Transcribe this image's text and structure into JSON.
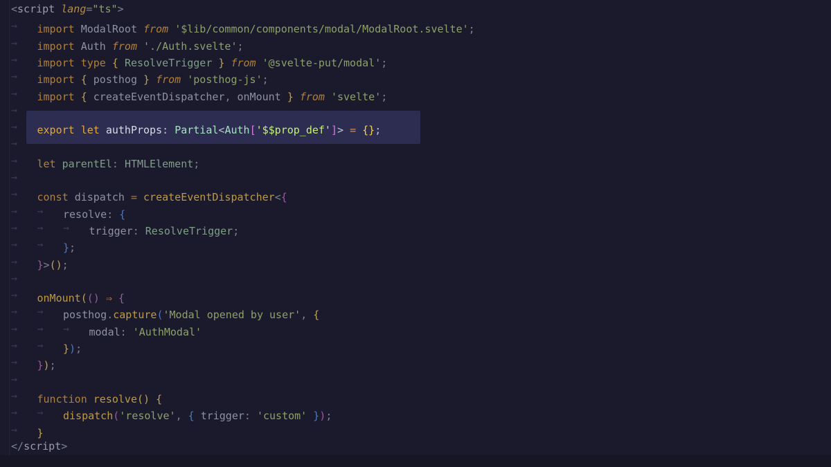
{
  "app": {
    "theme": {
      "background": "#1a1a2c",
      "current_line": "#2d2d52",
      "keyword": "#b0803a",
      "string": "#8ea06a",
      "type": "#7f9f86",
      "function": "#c09a3f"
    }
  },
  "editor": {
    "highlighted_line": 8,
    "lines": [
      {
        "tokens": [
          {
            "t": "<",
            "c": "t-p"
          },
          {
            "t": "script",
            "c": "t-tg"
          },
          {
            "t": " ",
            "c": ""
          },
          {
            "t": "lang",
            "c": "t-at"
          },
          {
            "t": "=",
            "c": "t-p"
          },
          {
            "t": "\"ts\"",
            "c": "t-st"
          },
          {
            "t": ">",
            "c": "t-p"
          }
        ]
      },
      {
        "indent": 1,
        "tokens": [
          {
            "t": "import",
            "c": "t-kw"
          },
          {
            "t": " ",
            "c": ""
          },
          {
            "t": "ModalRoot",
            "c": "t-id"
          },
          {
            "t": " ",
            "c": ""
          },
          {
            "t": "from",
            "c": "t-fr"
          },
          {
            "t": " ",
            "c": ""
          },
          {
            "t": "'$lib/common/components/modal/ModalRoot.svelte'",
            "c": "t-st"
          },
          {
            "t": ";",
            "c": "t-p"
          }
        ]
      },
      {
        "indent": 1,
        "tokens": [
          {
            "t": "import",
            "c": "t-kw"
          },
          {
            "t": " ",
            "c": ""
          },
          {
            "t": "Auth",
            "c": "t-id"
          },
          {
            "t": " ",
            "c": ""
          },
          {
            "t": "from",
            "c": "t-fr"
          },
          {
            "t": " ",
            "c": ""
          },
          {
            "t": "'./Auth.svelte'",
            "c": "t-st"
          },
          {
            "t": ";",
            "c": "t-p"
          }
        ]
      },
      {
        "indent": 1,
        "tokens": [
          {
            "t": "import",
            "c": "t-kw"
          },
          {
            "t": " ",
            "c": ""
          },
          {
            "t": "type",
            "c": "t-kw"
          },
          {
            "t": " ",
            "c": ""
          },
          {
            "t": "{",
            "c": "t-b1"
          },
          {
            "t": " ",
            "c": ""
          },
          {
            "t": "ResolveTrigger",
            "c": "t-ty"
          },
          {
            "t": " ",
            "c": ""
          },
          {
            "t": "}",
            "c": "t-b1"
          },
          {
            "t": " ",
            "c": ""
          },
          {
            "t": "from",
            "c": "t-fr"
          },
          {
            "t": " ",
            "c": ""
          },
          {
            "t": "'@svelte-put/modal'",
            "c": "t-st"
          },
          {
            "t": ";",
            "c": "t-p"
          }
        ]
      },
      {
        "indent": 1,
        "tokens": [
          {
            "t": "import",
            "c": "t-kw"
          },
          {
            "t": " ",
            "c": ""
          },
          {
            "t": "{",
            "c": "t-b1"
          },
          {
            "t": " ",
            "c": ""
          },
          {
            "t": "posthog",
            "c": "t-id"
          },
          {
            "t": " ",
            "c": ""
          },
          {
            "t": "}",
            "c": "t-b1"
          },
          {
            "t": " ",
            "c": ""
          },
          {
            "t": "from",
            "c": "t-fr"
          },
          {
            "t": " ",
            "c": ""
          },
          {
            "t": "'posthog-js'",
            "c": "t-st"
          },
          {
            "t": ";",
            "c": "t-p"
          }
        ]
      },
      {
        "indent": 1,
        "tokens": [
          {
            "t": "import",
            "c": "t-kw"
          },
          {
            "t": " ",
            "c": ""
          },
          {
            "t": "{",
            "c": "t-b1"
          },
          {
            "t": " ",
            "c": ""
          },
          {
            "t": "createEventDispatcher",
            "c": "t-id"
          },
          {
            "t": ",",
            "c": "t-p"
          },
          {
            "t": " ",
            "c": ""
          },
          {
            "t": "onMount",
            "c": "t-id"
          },
          {
            "t": " ",
            "c": ""
          },
          {
            "t": "}",
            "c": "t-b1"
          },
          {
            "t": " ",
            "c": ""
          },
          {
            "t": "from",
            "c": "t-fr"
          },
          {
            "t": " ",
            "c": ""
          },
          {
            "t": "'svelte'",
            "c": "t-st"
          },
          {
            "t": ";",
            "c": "t-p"
          }
        ]
      },
      {
        "indent": 1,
        "tokens": []
      },
      {
        "indent": 1,
        "tokens": [
          {
            "t": "export",
            "c": "t-kw"
          },
          {
            "t": " ",
            "c": ""
          },
          {
            "t": "let",
            "c": "t-kw"
          },
          {
            "t": " ",
            "c": ""
          },
          {
            "t": "authProps",
            "c": "t-id"
          },
          {
            "t": ":",
            "c": "t-p"
          },
          {
            "t": " ",
            "c": ""
          },
          {
            "t": "Partial",
            "c": "t-ty"
          },
          {
            "t": "<",
            "c": "t-p"
          },
          {
            "t": "Auth",
            "c": "t-ty"
          },
          {
            "t": "[",
            "c": "t-b2"
          },
          {
            "t": "'$$prop_def'",
            "c": "t-st"
          },
          {
            "t": "]",
            "c": "t-b2"
          },
          {
            "t": ">",
            "c": "t-p"
          },
          {
            "t": " ",
            "c": ""
          },
          {
            "t": "=",
            "c": "t-op"
          },
          {
            "t": " ",
            "c": ""
          },
          {
            "t": "{}",
            "c": "t-b1"
          },
          {
            "t": ";",
            "c": "t-p"
          }
        ]
      },
      {
        "indent": 1,
        "tokens": []
      },
      {
        "indent": 1,
        "tokens": [
          {
            "t": "let",
            "c": "t-kw"
          },
          {
            "t": " ",
            "c": ""
          },
          {
            "t": "parentEl",
            "c": "t-ty"
          },
          {
            "t": ":",
            "c": "t-p"
          },
          {
            "t": " ",
            "c": ""
          },
          {
            "t": "HTMLElement",
            "c": "t-ty"
          },
          {
            "t": ";",
            "c": "t-p"
          }
        ]
      },
      {
        "indent": 1,
        "tokens": []
      },
      {
        "indent": 1,
        "tokens": [
          {
            "t": "const",
            "c": "t-kw"
          },
          {
            "t": " ",
            "c": ""
          },
          {
            "t": "dispatch",
            "c": "t-id"
          },
          {
            "t": " ",
            "c": ""
          },
          {
            "t": "=",
            "c": "t-op"
          },
          {
            "t": " ",
            "c": ""
          },
          {
            "t": "createEventDispatcher",
            "c": "t-fn"
          },
          {
            "t": "<",
            "c": "t-p"
          },
          {
            "t": "{",
            "c": "t-b2"
          }
        ]
      },
      {
        "indent": 2,
        "tokens": [
          {
            "t": "resolve",
            "c": "t-pr"
          },
          {
            "t": ":",
            "c": "t-p"
          },
          {
            "t": " ",
            "c": ""
          },
          {
            "t": "{",
            "c": "t-b3"
          }
        ]
      },
      {
        "indent": 3,
        "tokens": [
          {
            "t": "trigger",
            "c": "t-pr"
          },
          {
            "t": ":",
            "c": "t-p"
          },
          {
            "t": " ",
            "c": ""
          },
          {
            "t": "ResolveTrigger",
            "c": "t-ty"
          },
          {
            "t": ";",
            "c": "t-p"
          }
        ]
      },
      {
        "indent": 2,
        "tokens": [
          {
            "t": "}",
            "c": "t-b3"
          },
          {
            "t": ";",
            "c": "t-p"
          }
        ]
      },
      {
        "indent": 1,
        "tokens": [
          {
            "t": "}",
            "c": "t-b2"
          },
          {
            "t": ">",
            "c": "t-p"
          },
          {
            "t": "()",
            "c": "t-b1"
          },
          {
            "t": ";",
            "c": "t-p"
          }
        ]
      },
      {
        "indent": 1,
        "tokens": []
      },
      {
        "indent": 1,
        "tokens": [
          {
            "t": "onMount",
            "c": "t-fn"
          },
          {
            "t": "(",
            "c": "t-b1"
          },
          {
            "t": "()",
            "c": "t-b2"
          },
          {
            "t": " ",
            "c": ""
          },
          {
            "t": "⇒",
            "c": "t-op"
          },
          {
            "t": " ",
            "c": ""
          },
          {
            "t": "{",
            "c": "t-b2"
          }
        ]
      },
      {
        "indent": 2,
        "tokens": [
          {
            "t": "posthog",
            "c": "t-id"
          },
          {
            "t": ".",
            "c": "t-p"
          },
          {
            "t": "capture",
            "c": "t-fn"
          },
          {
            "t": "(",
            "c": "t-b3"
          },
          {
            "t": "'Modal opened by user'",
            "c": "t-st"
          },
          {
            "t": ",",
            "c": "t-p"
          },
          {
            "t": " ",
            "c": ""
          },
          {
            "t": "{",
            "c": "t-b1"
          }
        ]
      },
      {
        "indent": 3,
        "tokens": [
          {
            "t": "modal",
            "c": "t-pr"
          },
          {
            "t": ":",
            "c": "t-p"
          },
          {
            "t": " ",
            "c": ""
          },
          {
            "t": "'AuthModal'",
            "c": "t-st"
          }
        ]
      },
      {
        "indent": 2,
        "tokens": [
          {
            "t": "}",
            "c": "t-b1"
          },
          {
            "t": ")",
            "c": "t-b3"
          },
          {
            "t": ";",
            "c": "t-p"
          }
        ]
      },
      {
        "indent": 1,
        "tokens": [
          {
            "t": "}",
            "c": "t-b2"
          },
          {
            "t": ")",
            "c": "t-b1"
          },
          {
            "t": ";",
            "c": "t-p"
          }
        ]
      },
      {
        "indent": 1,
        "tokens": []
      },
      {
        "indent": 1,
        "tokens": [
          {
            "t": "function",
            "c": "t-kw"
          },
          {
            "t": " ",
            "c": ""
          },
          {
            "t": "resolve",
            "c": "t-fn"
          },
          {
            "t": "()",
            "c": "t-b1"
          },
          {
            "t": " ",
            "c": ""
          },
          {
            "t": "{",
            "c": "t-b1"
          }
        ]
      },
      {
        "indent": 2,
        "tokens": [
          {
            "t": "dispatch",
            "c": "t-fn"
          },
          {
            "t": "(",
            "c": "t-b2"
          },
          {
            "t": "'resolve'",
            "c": "t-st"
          },
          {
            "t": ",",
            "c": "t-p"
          },
          {
            "t": " ",
            "c": ""
          },
          {
            "t": "{",
            "c": "t-b3"
          },
          {
            "t": " ",
            "c": ""
          },
          {
            "t": "trigger",
            "c": "t-pr"
          },
          {
            "t": ":",
            "c": "t-p"
          },
          {
            "t": " ",
            "c": ""
          },
          {
            "t": "'custom'",
            "c": "t-st"
          },
          {
            "t": " ",
            "c": ""
          },
          {
            "t": "}",
            "c": "t-b3"
          },
          {
            "t": ")",
            "c": "t-b2"
          },
          {
            "t": ";",
            "c": "t-p"
          }
        ]
      },
      {
        "indent": 1,
        "tokens": [
          {
            "t": "}",
            "c": "t-b1"
          }
        ]
      },
      {
        "tokens": [
          {
            "t": "</",
            "c": "t-p"
          },
          {
            "t": "script",
            "c": "t-tg"
          },
          {
            "t": ">",
            "c": "t-p"
          }
        ]
      }
    ]
  }
}
